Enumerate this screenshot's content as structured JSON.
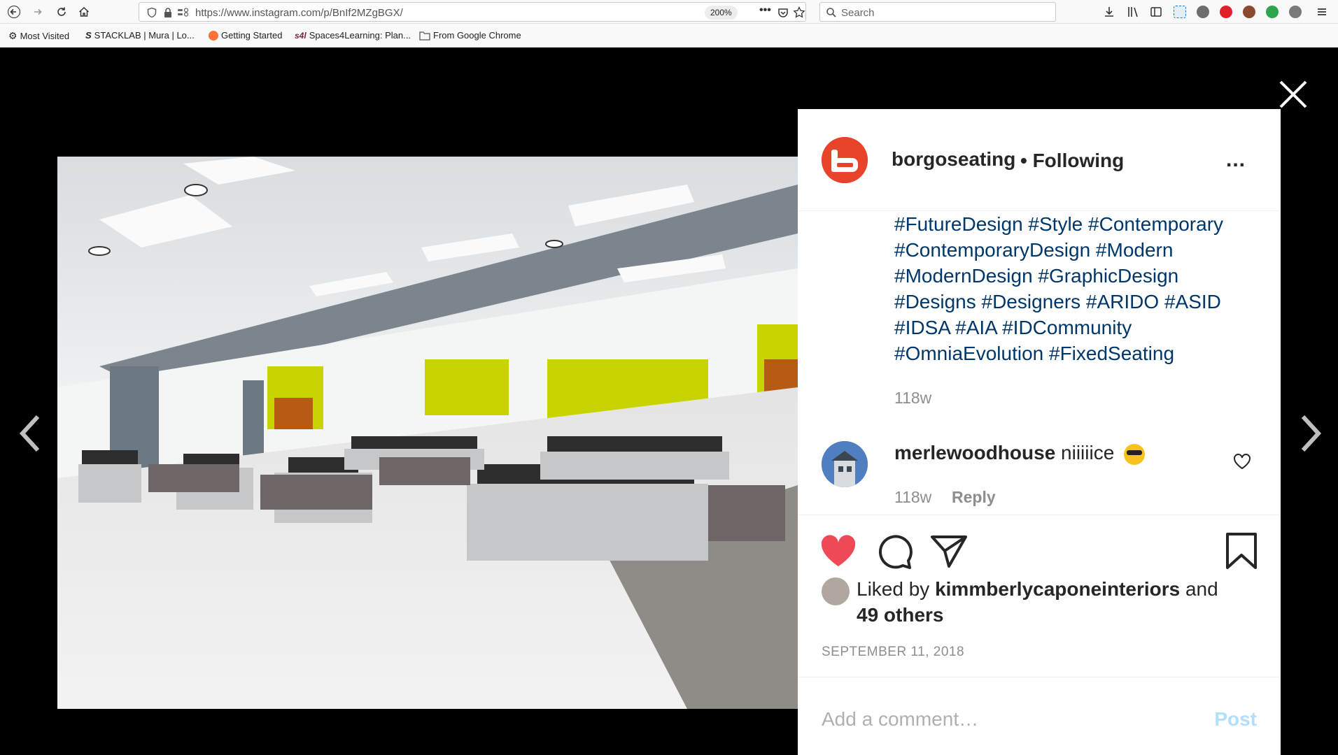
{
  "browser": {
    "url": "https://www.instagram.com/p/BnIf2MZgBGX/",
    "zoom": "200%",
    "search_placeholder": "Search",
    "bookmarks": [
      "Most Visited",
      "STACKLAB | Mura | Lo...",
      "Getting Started",
      "Spaces4Learning: Plan...",
      "From Google Chrome"
    ]
  },
  "post": {
    "username": "borgoseating",
    "following": "• Following",
    "more_icon": "...",
    "caption_tags": [
      "#FutureDesign #Style #Contemporary",
      "#ContemporaryDesign #Modern",
      "#ModernDesign #GraphicDesign",
      "#Designs #Designers #ARIDO #ASID",
      "#IDSA #AIA #IDCommunity",
      "#OmniaEvolution #FixedSeating"
    ],
    "caption_time": "118w",
    "comment": {
      "username": "merlewoodhouse",
      "text": "niiiiice",
      "time": "118w",
      "reply": "Reply"
    },
    "liked_by_prefix": "Liked by",
    "liked_by_user": "kimmberlycaponeinteriors",
    "liked_by_and": "and",
    "liked_by_others": "49 others",
    "date": "SEPTEMBER 11, 2018",
    "add_comment_placeholder": "Add a comment…",
    "post_button": "Post"
  },
  "colors": {
    "heart": "#ed4956",
    "brand_avatar": "#e8432b",
    "hashtag": "#00376b"
  }
}
